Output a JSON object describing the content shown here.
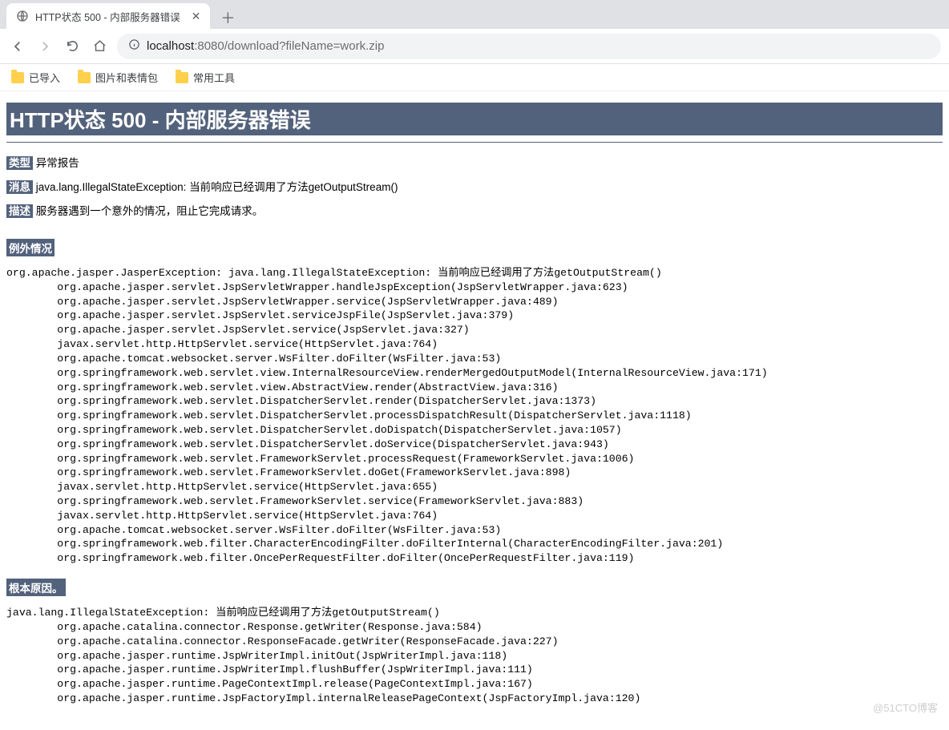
{
  "browser": {
    "tab_title": "HTTP状态 500 - 内部服务器错误",
    "url_host": "localhost",
    "url_port": ":8080",
    "url_path": "/download?fileName=work.zip",
    "bookmarks": [
      "已导入",
      "图片和表情包",
      "常用工具"
    ]
  },
  "page": {
    "heading": "HTTP状态 500 - 内部服务器错误",
    "type_label": "类型",
    "type_value": "异常报告",
    "message_label": "消息",
    "message_value": "java.lang.IllegalStateException: 当前响应已经调用了方法getOutputStream()",
    "desc_label": "描述",
    "desc_value": "服务器遇到一个意外的情况，阻止它完成请求。",
    "exception_label": "例外情况",
    "rootcause_label": "根本原因。",
    "exception_trace": "org.apache.jasper.JasperException: java.lang.IllegalStateException: 当前响应已经调用了方法getOutputStream()\n        org.apache.jasper.servlet.JspServletWrapper.handleJspException(JspServletWrapper.java:623)\n        org.apache.jasper.servlet.JspServletWrapper.service(JspServletWrapper.java:489)\n        org.apache.jasper.servlet.JspServlet.serviceJspFile(JspServlet.java:379)\n        org.apache.jasper.servlet.JspServlet.service(JspServlet.java:327)\n        javax.servlet.http.HttpServlet.service(HttpServlet.java:764)\n        org.apache.tomcat.websocket.server.WsFilter.doFilter(WsFilter.java:53)\n        org.springframework.web.servlet.view.InternalResourceView.renderMergedOutputModel(InternalResourceView.java:171)\n        org.springframework.web.servlet.view.AbstractView.render(AbstractView.java:316)\n        org.springframework.web.servlet.DispatcherServlet.render(DispatcherServlet.java:1373)\n        org.springframework.web.servlet.DispatcherServlet.processDispatchResult(DispatcherServlet.java:1118)\n        org.springframework.web.servlet.DispatcherServlet.doDispatch(DispatcherServlet.java:1057)\n        org.springframework.web.servlet.DispatcherServlet.doService(DispatcherServlet.java:943)\n        org.springframework.web.servlet.FrameworkServlet.processRequest(FrameworkServlet.java:1006)\n        org.springframework.web.servlet.FrameworkServlet.doGet(FrameworkServlet.java:898)\n        javax.servlet.http.HttpServlet.service(HttpServlet.java:655)\n        org.springframework.web.servlet.FrameworkServlet.service(FrameworkServlet.java:883)\n        javax.servlet.http.HttpServlet.service(HttpServlet.java:764)\n        org.apache.tomcat.websocket.server.WsFilter.doFilter(WsFilter.java:53)\n        org.springframework.web.filter.CharacterEncodingFilter.doFilterInternal(CharacterEncodingFilter.java:201)\n        org.springframework.web.filter.OncePerRequestFilter.doFilter(OncePerRequestFilter.java:119)",
    "rootcause_trace": "java.lang.IllegalStateException: 当前响应已经调用了方法getOutputStream()\n        org.apache.catalina.connector.Response.getWriter(Response.java:584)\n        org.apache.catalina.connector.ResponseFacade.getWriter(ResponseFacade.java:227)\n        org.apache.jasper.runtime.JspWriterImpl.initOut(JspWriterImpl.java:118)\n        org.apache.jasper.runtime.JspWriterImpl.flushBuffer(JspWriterImpl.java:111)\n        org.apache.jasper.runtime.PageContextImpl.release(PageContextImpl.java:167)\n        org.apache.jasper.runtime.JspFactoryImpl.internalReleasePageContext(JspFactoryImpl.java:120)"
  },
  "watermark": "@51CTO博客"
}
